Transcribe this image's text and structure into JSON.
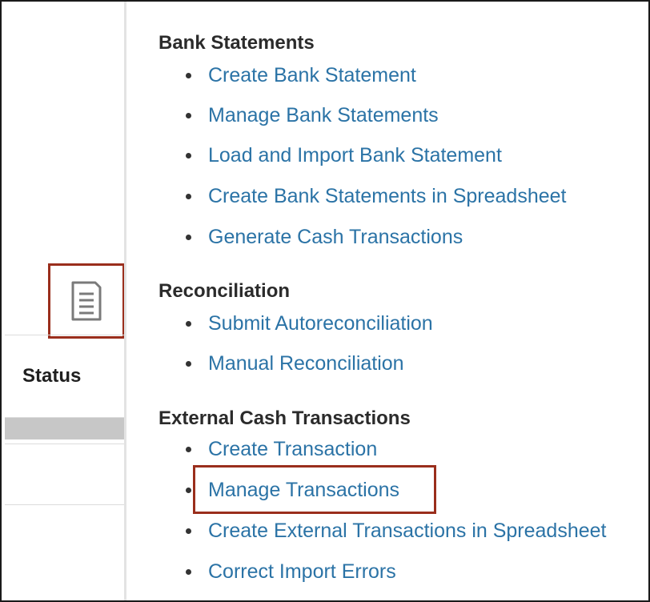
{
  "left_pane": {
    "tasks_icon": "document-list-icon",
    "status_header": "Status"
  },
  "task_groups": [
    {
      "title": "Bank Statements",
      "items": [
        "Create Bank Statement",
        "Manage Bank Statements",
        "Load and Import Bank Statement",
        "Create Bank Statements in Spreadsheet",
        "Generate Cash Transactions"
      ]
    },
    {
      "title": "Reconciliation",
      "items": [
        "Submit Autoreconciliation",
        "Manual Reconciliation"
      ]
    },
    {
      "title": "External Cash Transactions",
      "items": [
        "Create Transaction",
        "Manage Transactions",
        "Create External Transactions in Spreadsheet",
        "Correct Import Errors"
      ]
    }
  ],
  "colors": {
    "link": "#2b73a6",
    "highlight_border": "#9a2e1c",
    "heading": "#2b2b2b"
  }
}
